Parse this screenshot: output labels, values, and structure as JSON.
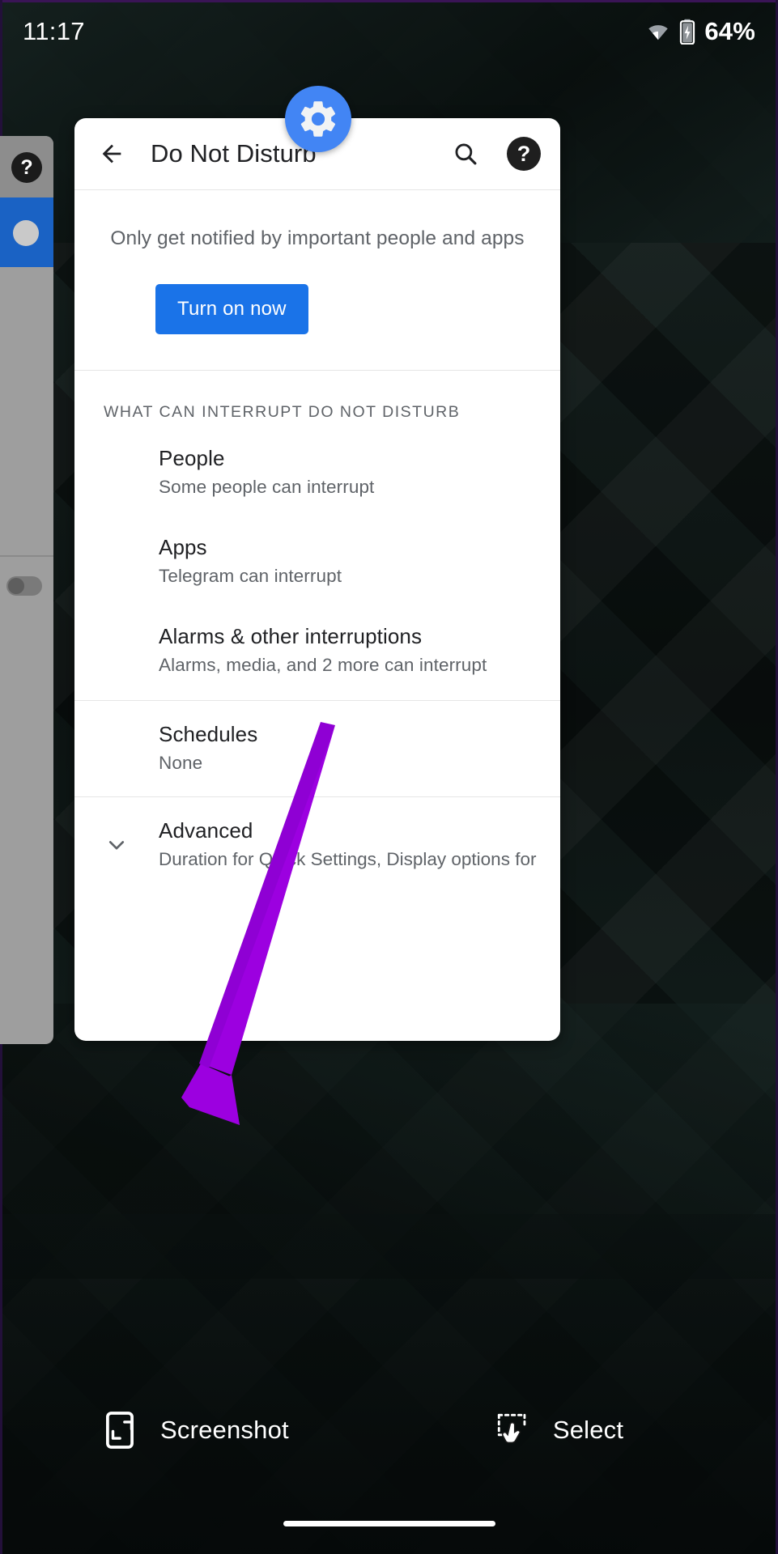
{
  "status_bar": {
    "time": "11:17",
    "battery_percent": "64%",
    "wifi_icon": "wifi-icon",
    "battery_icon": "battery-charging-icon"
  },
  "app_bar": {
    "back_icon": "back-arrow-icon",
    "title": "Do Not Disturb",
    "search_icon": "search-icon",
    "help_icon": "help-circle-icon"
  },
  "gear_badge": {
    "icon": "settings-gear-icon",
    "color": "#4285f4"
  },
  "intro": {
    "description": "Only get notified by important people and apps",
    "button_label": "Turn on now",
    "button_color": "#1a73e8"
  },
  "section": {
    "label": "WHAT CAN INTERRUPT DO NOT DISTURB"
  },
  "rows": [
    {
      "title": "People",
      "subtitle": "Some people can interrupt"
    },
    {
      "title": "Apps",
      "subtitle": "Telegram can interrupt"
    },
    {
      "title": "Alarms & other interruptions",
      "subtitle": "Alarms, media, and 2 more can interrupt"
    },
    {
      "title": "Schedules",
      "subtitle": "None"
    }
  ],
  "advanced": {
    "chevron_icon": "chevron-down-icon",
    "title": "Advanced",
    "subtitle": "Duration for Quick Settings, Display options for hid.."
  },
  "background_panel": {
    "help_badge": "?",
    "help_icon": "help-circle-icon",
    "selected_dot": "selected-dot-icon",
    "toggle": "toggle-switch-off"
  },
  "bottom_bar": {
    "screenshot_icon": "screenshot-phone-icon",
    "screenshot_label": "Screenshot",
    "select_icon": "select-hand-icon",
    "select_label": "Select"
  },
  "annotation": {
    "arrow_color": "#9c00e0",
    "points_to": "Screenshot"
  }
}
